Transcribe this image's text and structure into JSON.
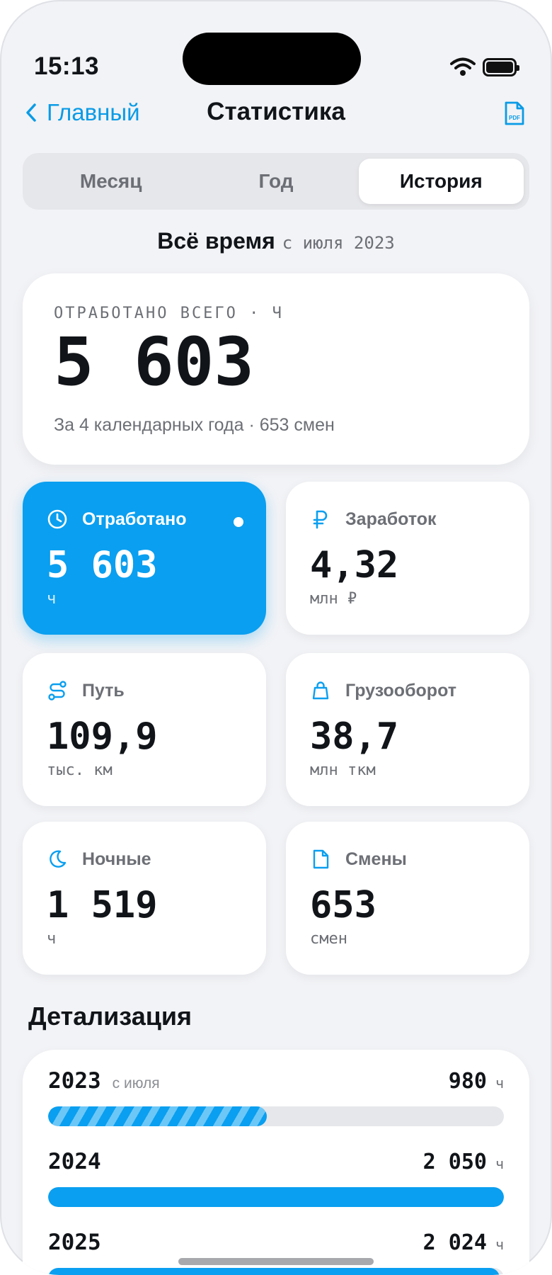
{
  "status_bar": {
    "time": "15:13"
  },
  "nav": {
    "back_label": "Главный",
    "title": "Статистика",
    "pdf_label": "PDF"
  },
  "segments": [
    "Месяц",
    "Год",
    "История"
  ],
  "active_segment": "История",
  "period": {
    "title": "Всё время",
    "since": "с июля 2023"
  },
  "summary": {
    "label": "ОТРАБОТАНО ВСЕГО · Ч",
    "value": "5 603",
    "subtitle": "За 4 календарных года · 653 смен"
  },
  "cards": [
    {
      "title": "Отработано",
      "value": "5 603",
      "unit": "ч",
      "icon": "clock-icon",
      "active": true
    },
    {
      "title": "Заработок",
      "value": "4,32",
      "unit": "млн ₽",
      "icon": "ruble-icon",
      "active": false
    },
    {
      "title": "Путь",
      "value": "109,9",
      "unit": "тыс. км",
      "icon": "route-icon",
      "active": false
    },
    {
      "title": "Грузооборот",
      "value": "38,7",
      "unit": "млн ткм",
      "icon": "cargo-bag-icon",
      "active": false
    },
    {
      "title": "Ночные",
      "value": "1 519",
      "unit": "ч",
      "icon": "moon-icon",
      "active": false
    },
    {
      "title": "Смены",
      "value": "653",
      "unit": "смен",
      "icon": "document-icon",
      "active": false
    }
  ],
  "details": {
    "title": "Детализация",
    "rows": [
      {
        "year": "2023",
        "note": "с июля",
        "hours": "980",
        "unit": "ч",
        "progress": 0.48,
        "partial": true
      },
      {
        "year": "2024",
        "note": "",
        "hours": "2 050",
        "unit": "ч",
        "progress": 1.0,
        "partial": false
      },
      {
        "year": "2025",
        "note": "",
        "hours": "2 024",
        "unit": "ч",
        "progress": 0.99,
        "partial": false
      }
    ]
  },
  "colors": {
    "accent": "#0a9ff0",
    "background": "#f2f3f6",
    "card": "#ffffff",
    "muted": "#6c6f75"
  }
}
